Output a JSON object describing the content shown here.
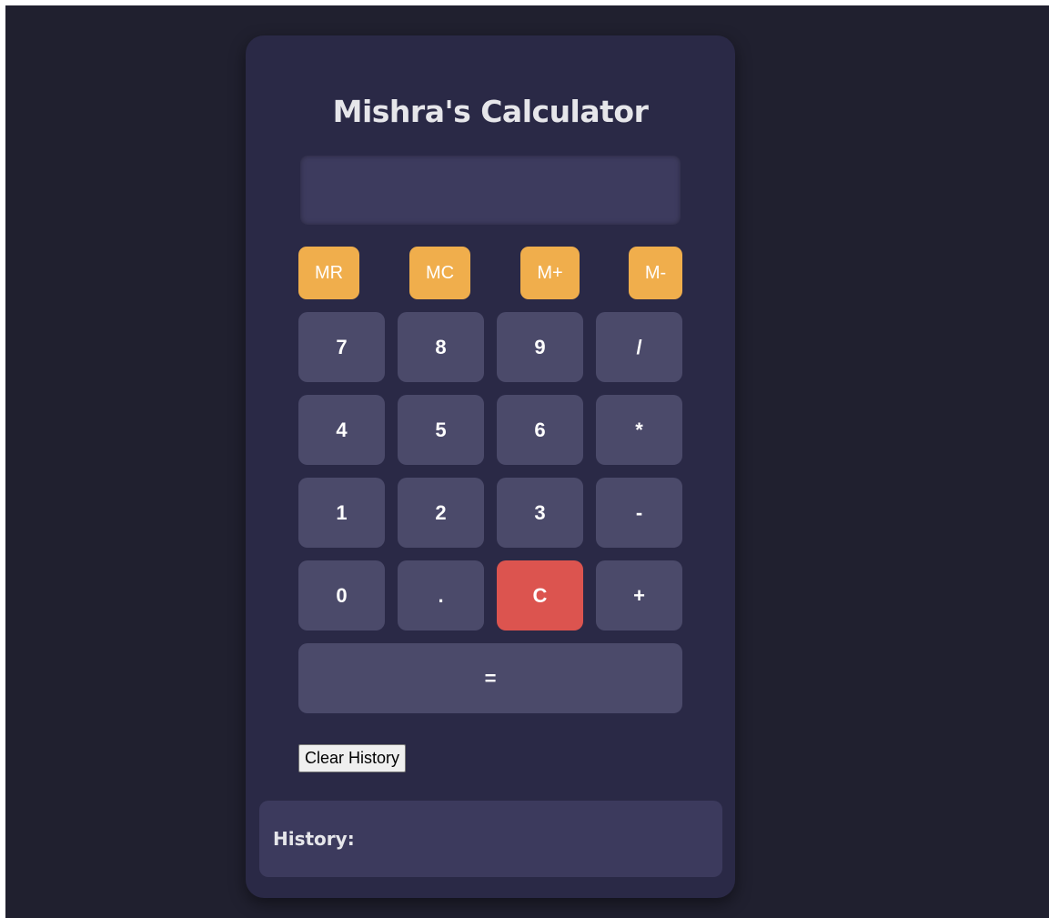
{
  "app": {
    "title": "Mishra's Calculator"
  },
  "display": {
    "value": ""
  },
  "memory_buttons": [
    "MR",
    "MC",
    "M+",
    "M-"
  ],
  "keypad": {
    "row1": [
      "7",
      "8",
      "9",
      "/"
    ],
    "row2": [
      "4",
      "5",
      "6",
      "*"
    ],
    "row3": [
      "1",
      "2",
      "3",
      "-"
    ],
    "row4": [
      "0",
      ".",
      "C",
      "+"
    ],
    "equals": "="
  },
  "clear_history_label": "Clear History",
  "history": {
    "title": "History:",
    "entries": []
  },
  "colors": {
    "page_background": "#20202f",
    "card_background": "#2a2946",
    "key_background": "#4b4a6a",
    "memory_accent": "#f0ae4c",
    "clear_accent": "#dc544f",
    "display_background": "#3d3b5e"
  }
}
